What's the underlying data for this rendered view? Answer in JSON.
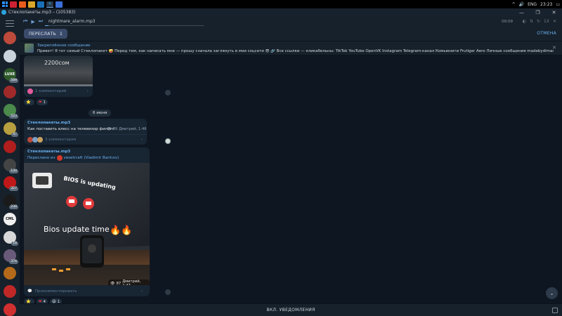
{
  "taskbar": {
    "lang": "ENG",
    "time": "23:23"
  },
  "window": {
    "title": "Стеклопакеты.mp3 – (105383)",
    "minimize": "—",
    "maximize": "❐",
    "close": "✕"
  },
  "sidebar": {
    "chats": [
      {
        "badge": "",
        "label": "",
        "color": "#bd4a3a"
      },
      {
        "badge": "",
        "label": "",
        "color": "#c9d3dc"
      },
      {
        "badge": "589",
        "label": "LUXE",
        "color": "#2e5a2a"
      },
      {
        "badge": "",
        "label": "",
        "color": "#a02a2a"
      },
      {
        "badge": "523",
        "label": "",
        "color": "#4a8a4a"
      },
      {
        "badge": "47",
        "label": "",
        "color": "#b8a040"
      },
      {
        "badge": "",
        "label": "",
        "color": "#b01e1e"
      },
      {
        "badge": "130",
        "label": "",
        "color": "#444"
      },
      {
        "badge": "327",
        "label": "",
        "color": "#c01818"
      },
      {
        "badge": "230",
        "label": "",
        "color": "#1a1a1a"
      },
      {
        "badge": "",
        "label": "CML",
        "color": "#f0f0f0"
      },
      {
        "badge": "18",
        "label": "",
        "color": "#d8d8d8"
      },
      {
        "badge": "376",
        "label": "",
        "color": "#6a5a7a"
      },
      {
        "badge": "",
        "label": "",
        "color": "#b46a1a"
      },
      {
        "badge": "",
        "label": "",
        "color": "#c02828"
      },
      {
        "badge": "",
        "label": "",
        "color": "#d03030"
      }
    ]
  },
  "player": {
    "track": "nightmare_alarm.mp3",
    "time": "00:09",
    "progress": 0.02
  },
  "selection": {
    "forward_label": "ПЕРЕСЛАТЬ",
    "forward_count": "1",
    "cancel_label": "ОТМЕНА"
  },
  "pinned": {
    "title": "Закреплённое сообщение",
    "text": "Привет! Я тот самый Стеклопакет 🤪 Перед тем, как написать мне — прошу сначала заглянуть в мои соцсети 😎 🔗 Все ссылки — кликабельны: TikTok YouTube OpenVK Instagram Telegram-канал Комьюнити Frutiger Aero Личные сообщения madebydimas.top ————————————"
  },
  "messages": {
    "first": {
      "price": "2200сом",
      "comments": "1 комментарий",
      "reactions": [
        {
          "emoji": "⭐",
          "count": ""
        },
        {
          "emoji": "❤",
          "count": "1"
        }
      ]
    },
    "date": "6 июня",
    "second": {
      "sender": "Стеклопакеты.mp3",
      "text": "Как поставить влесс на телевизор филипс",
      "views": "69",
      "meta": "Дмитрий, 1:46",
      "comments": "3 комментария"
    },
    "third": {
      "sender": "Стеклопакеты.mp3",
      "forwarded_prefix": "Переслано из",
      "forwarded_from": "veselcraft (Vladimir Barinov)",
      "photo_title": "BIOS is updating",
      "photo_caption": "Bios update time",
      "views": "87",
      "meta": "Дмитрий, 1:47",
      "comment_placeholder": "Прокомментировать",
      "reactions": [
        {
          "emoji": "⭐",
          "count": ""
        },
        {
          "emoji": "❤",
          "count": "4"
        },
        {
          "emoji": "😆",
          "count": "1"
        }
      ]
    }
  },
  "bottom": {
    "notify_label": "ВКЛ. УВЕДОМЛЕНИЯ"
  }
}
